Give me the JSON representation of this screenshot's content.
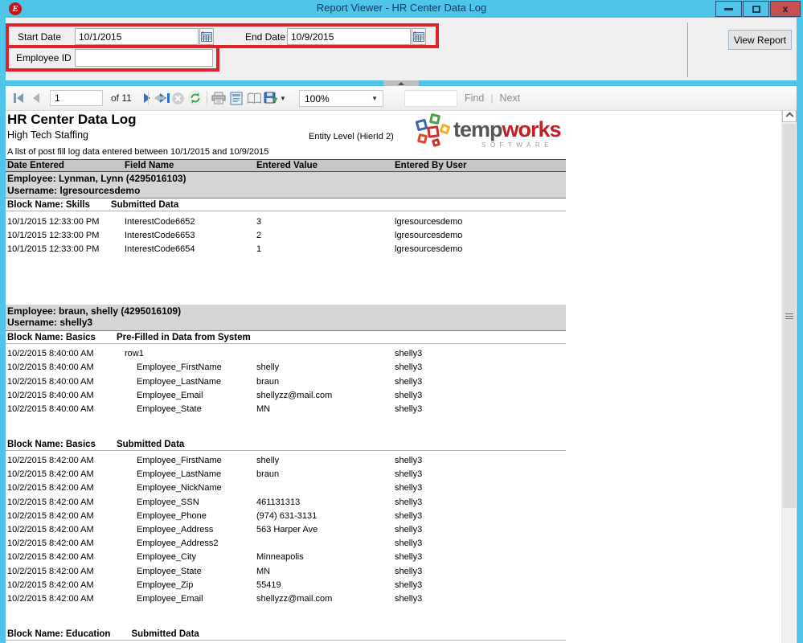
{
  "window": {
    "title": "Report Viewer - HR Center Data Log",
    "app_icon_letter": "E"
  },
  "params": {
    "start_date": {
      "label": "Start Date",
      "value": "10/1/2015"
    },
    "end_date": {
      "label": "End Date",
      "value": "10/9/2015"
    },
    "employee_id": {
      "label": "Employee ID",
      "value": ""
    },
    "view_report_label": "View Report"
  },
  "toolbar": {
    "page_value": "1",
    "pages_label": "of 11",
    "zoom_value": "100%",
    "find_label": "Find",
    "next_label": "Next",
    "icons": [
      "first-page",
      "previous-page",
      "next-page",
      "last-page",
      "back",
      "stop",
      "refresh",
      "print",
      "print-layout",
      "page-setup",
      "export",
      "export-dropdown"
    ]
  },
  "report": {
    "title": "HR Center Data Log",
    "company": "High Tech Staffing",
    "entity_level": "Entity Level (HierId 2)",
    "description": "A list of post fill log data entered between 10/1/2015 and 10/9/2015",
    "logo": {
      "word1": "temp",
      "word2": "works",
      "tagline": "SOFTWARE"
    },
    "columns": [
      "Date Entered",
      "Field Name",
      "Entered Value",
      "Entered By User"
    ],
    "sections": [
      {
        "employee": "Employee: Lynman, Lynn (4295016103)",
        "username": "Username: lgresourcesdemo",
        "blocks": [
          {
            "name": "Block Name: Skills",
            "type": "Submitted Data",
            "rows": [
              {
                "date": "10/1/2015 12:33:00 PM",
                "field": "InterestCode6652",
                "value": "3",
                "user": "lgresourcesdemo",
                "indent": false
              },
              {
                "date": "10/1/2015 12:33:00 PM",
                "field": "InterestCode6653",
                "value": "2",
                "user": "lgresourcesdemo",
                "indent": false
              },
              {
                "date": "10/1/2015 12:33:00 PM",
                "field": "InterestCode6654",
                "value": "1",
                "user": "lgresourcesdemo",
                "indent": false
              }
            ]
          }
        ]
      },
      {
        "employee": "Employee: braun, shelly (4295016109)",
        "username": "Username: shelly3",
        "blocks": [
          {
            "name": "Block Name: Basics",
            "type": "Pre-Filled in Data from System",
            "rows": [
              {
                "date": "10/2/2015 8:40:00 AM",
                "field": "row1",
                "value": "",
                "user": "shelly3",
                "indent": false
              },
              {
                "date": "10/2/2015 8:40:00 AM",
                "field": "Employee_FirstName",
                "value": "shelly",
                "user": "shelly3",
                "indent": true
              },
              {
                "date": "10/2/2015 8:40:00 AM",
                "field": "Employee_LastName",
                "value": "braun",
                "user": "shelly3",
                "indent": true
              },
              {
                "date": "10/2/2015 8:40:00 AM",
                "field": "Employee_Email",
                "value": "shellyzz@mail.com",
                "user": "shelly3",
                "indent": true
              },
              {
                "date": "10/2/2015 8:40:00 AM",
                "field": "Employee_State",
                "value": "MN",
                "user": "shelly3",
                "indent": true
              }
            ]
          },
          {
            "name": "Block Name: Basics",
            "type": "Submitted Data",
            "rows": [
              {
                "date": "10/2/2015 8:42:00 AM",
                "field": "Employee_FirstName",
                "value": "shelly",
                "user": "shelly3",
                "indent": true
              },
              {
                "date": "10/2/2015 8:42:00 AM",
                "field": "Employee_LastName",
                "value": "braun",
                "user": "shelly3",
                "indent": true
              },
              {
                "date": "10/2/2015 8:42:00 AM",
                "field": "Employee_NickName",
                "value": "",
                "user": "shelly3",
                "indent": true
              },
              {
                "date": "10/2/2015 8:42:00 AM",
                "field": "Employee_SSN",
                "value": "461131313",
                "user": "shelly3",
                "indent": true
              },
              {
                "date": "10/2/2015 8:42:00 AM",
                "field": "Employee_Phone",
                "value": "(974) 631-3131",
                "user": "shelly3",
                "indent": true
              },
              {
                "date": "10/2/2015 8:42:00 AM",
                "field": "Employee_Address",
                "value": "563 Harper Ave",
                "user": "shelly3",
                "indent": true
              },
              {
                "date": "10/2/2015 8:42:00 AM",
                "field": "Employee_Address2",
                "value": "",
                "user": "shelly3",
                "indent": true
              },
              {
                "date": "10/2/2015 8:42:00 AM",
                "field": "Employee_City",
                "value": "Minneapolis",
                "user": "shelly3",
                "indent": true
              },
              {
                "date": "10/2/2015 8:42:00 AM",
                "field": "Employee_State",
                "value": "MN",
                "user": "shelly3",
                "indent": true
              },
              {
                "date": "10/2/2015 8:42:00 AM",
                "field": "Employee_Zip",
                "value": "55419",
                "user": "shelly3",
                "indent": true
              },
              {
                "date": "10/2/2015 8:42:00 AM",
                "field": "Employee_Email",
                "value": "shellyzz@mail.com",
                "user": "shelly3",
                "indent": true
              }
            ]
          },
          {
            "name": "Block Name: Education",
            "type": "Submitted Data",
            "rows": []
          }
        ]
      }
    ]
  },
  "colors": {
    "titlebar": "#4EC5E8",
    "close_button": "#C75050",
    "annotation_red": "#E3232B",
    "table_header_bg": "#C6C6C6",
    "employee_band_bg": "#D5D5D5",
    "logo_red": "#BE2026",
    "logo_gray": "#55565A",
    "nav_active_blue": "#2F6FD0",
    "refresh_green": "#3FA54B"
  }
}
